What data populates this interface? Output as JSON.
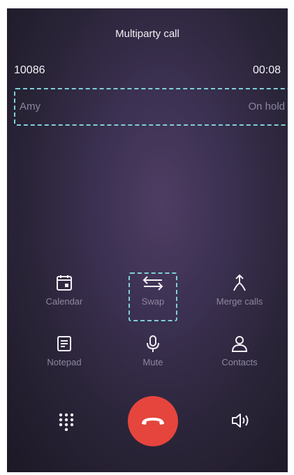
{
  "header": {
    "title": "Multiparty call"
  },
  "active_call": {
    "number": "10086",
    "duration": "00:08"
  },
  "held_call": {
    "name": "Amy",
    "status": "On hold"
  },
  "actions": {
    "calendar": {
      "label": "Calendar",
      "icon": "calendar-icon"
    },
    "swap": {
      "label": "Swap",
      "icon": "swap-arrows-icon"
    },
    "merge": {
      "label": "Merge calls",
      "icon": "merge-calls-icon"
    },
    "notepad": {
      "label": "Notepad",
      "icon": "notepad-icon"
    },
    "mute": {
      "label": "Mute",
      "icon": "microphone-icon"
    },
    "contacts": {
      "label": "Contacts",
      "icon": "person-icon"
    }
  },
  "bottom_bar": {
    "dialpad_icon": "dialpad-icon",
    "end_call_icon": "end-call-icon",
    "speaker_icon": "speaker-icon"
  },
  "colors": {
    "end_call": "#e5453c",
    "highlight_outline": "#7fd0d8",
    "icon": "#f2f0f5",
    "label": "#8e889f"
  }
}
